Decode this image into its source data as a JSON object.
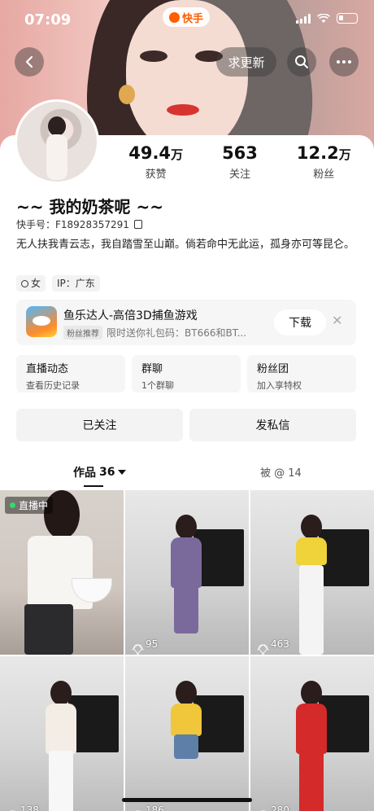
{
  "status_bar": {
    "time": "07:09"
  },
  "app": {
    "name": "快手"
  },
  "top_bar": {
    "ask_update_label": "求更新"
  },
  "stats": [
    {
      "value": "49.4",
      "unit": "万",
      "label": "获赞"
    },
    {
      "value": "563",
      "unit": "",
      "label": "关注"
    },
    {
      "value": "12.2",
      "unit": "万",
      "label": "粉丝"
    }
  ],
  "profile": {
    "nickname": "~~ 我的奶茶呢 ~~",
    "uid": "快手号：F18928357291",
    "bio": "无人扶我青云志，我自踏雪至山巅。倘若命中无此运，孤身亦可等昆仑。",
    "tags": {
      "gender": "女",
      "ip": "IP：广东"
    }
  },
  "ad": {
    "title": "鱼乐达人-高倍3D捕鱼游戏",
    "badge": "粉丝推荐",
    "subtitle": "限时送你礼包码：BT666和BT...",
    "download_label": "下载",
    "close_label": "✕"
  },
  "features": [
    {
      "title": "直播动态",
      "sub": "查看历史记录"
    },
    {
      "title": "群聊",
      "sub": "1个群聊"
    },
    {
      "title": "粉丝团",
      "sub": "加入享特权"
    }
  ],
  "actions": {
    "following_label": "已关注",
    "message_label": "发私信"
  },
  "tabs": {
    "works_label": "作品",
    "works_count": "36",
    "tagged_label": "被 @ 14"
  },
  "videos": [
    {
      "live_label": "直播中",
      "likes": ""
    },
    {
      "likes": "95"
    },
    {
      "likes": "463"
    },
    {
      "likes": "138"
    },
    {
      "likes": "186"
    },
    {
      "likes": "280"
    }
  ],
  "colors": {
    "brand": "#ff5d00",
    "live": "#33d96b"
  }
}
